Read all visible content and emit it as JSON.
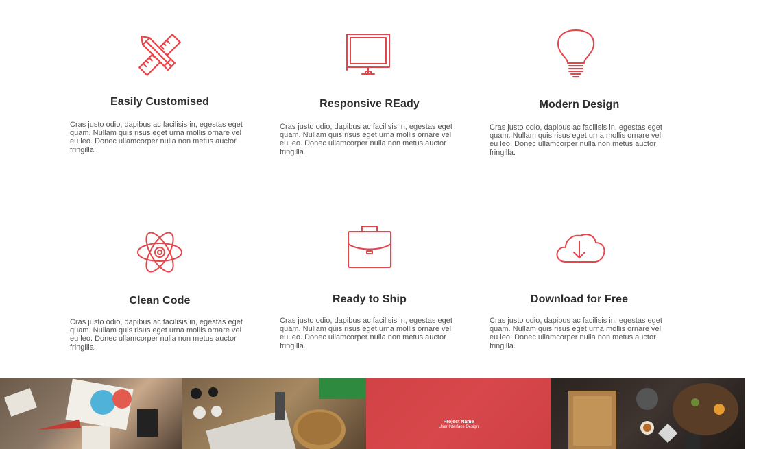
{
  "colors": {
    "accent": "#e4464b",
    "heading": "#2e2e2e",
    "body": "#555555"
  },
  "features": [
    {
      "icon": "pencil-ruler-icon",
      "title": "Easily Customised",
      "text": "Cras justo odio, dapibus ac facilisis in, egestas eget quam. Nullam quis risus eget urna mollis ornare vel eu leo. Donec ullamcorper nulla non metus auctor fringilla."
    },
    {
      "icon": "monitor-icon",
      "title": "Responsive REady",
      "text": "Cras justo odio, dapibus ac facilisis in, egestas eget quam. Nullam quis risus eget urna mollis ornare vel eu leo. Donec ullamcorper nulla non metus auctor fringilla."
    },
    {
      "icon": "lightbulb-icon",
      "title": "Modern Design",
      "text": "Cras justo odio, dapibus ac facilisis in, egestas eget quam. Nullam quis risus eget urna mollis ornare vel eu leo. Donec ullamcorper nulla non metus auctor fringilla."
    },
    {
      "icon": "atom-icon",
      "title": "Clean Code",
      "text": "Cras justo odio, dapibus ac facilisis in, egestas eget quam. Nullam quis risus eget urna mollis ornare vel eu leo. Donec ullamcorper nulla non metus auctor fringilla."
    },
    {
      "icon": "briefcase-icon",
      "title": "Ready to Ship",
      "text": "Cras justo odio, dapibus ac facilisis in, egestas eget quam. Nullam quis risus eget urna mollis ornare vel eu leo. Donec ullamcorper nulla non metus auctor fringilla."
    },
    {
      "icon": "cloud-download-icon",
      "title": "Download for Free",
      "text": "Cras justo odio, dapibus ac facilisis in, egestas eget quam. Nullam quis risus eget urna mollis ornare vel eu leo. Donec ullamcorper nulla non metus auctor fringilla."
    }
  ],
  "portfolio": {
    "hover_item": {
      "name": "Project Name",
      "category": "User Interface Design"
    }
  }
}
